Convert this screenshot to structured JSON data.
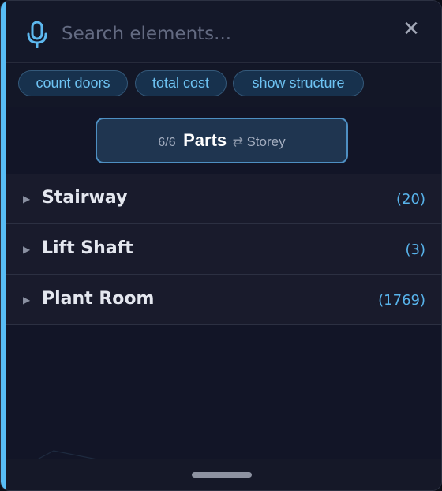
{
  "search": {
    "placeholder": "Search elements...",
    "value": ""
  },
  "icons": {
    "mic": "microphone-icon",
    "close": "close-icon",
    "expand": "triangle-right-icon"
  },
  "chips": [
    {
      "label": "count doors"
    },
    {
      "label": "total cost"
    },
    {
      "label": "show structure"
    }
  ],
  "grouping": {
    "count": "6/6",
    "active": "Parts",
    "swap_glyph": "⇄",
    "alternate": "Storey"
  },
  "groups": [
    {
      "name": "Stairway",
      "count": "(20)"
    },
    {
      "name": "Lift Shaft",
      "count": "(3)"
    },
    {
      "name": "Plant Room",
      "count": "(1769)"
    }
  ],
  "colors": {
    "accent": "#58bdf5",
    "chip_text": "#6ec3f3",
    "count_text": "#58b4ec",
    "background": "#121527"
  }
}
